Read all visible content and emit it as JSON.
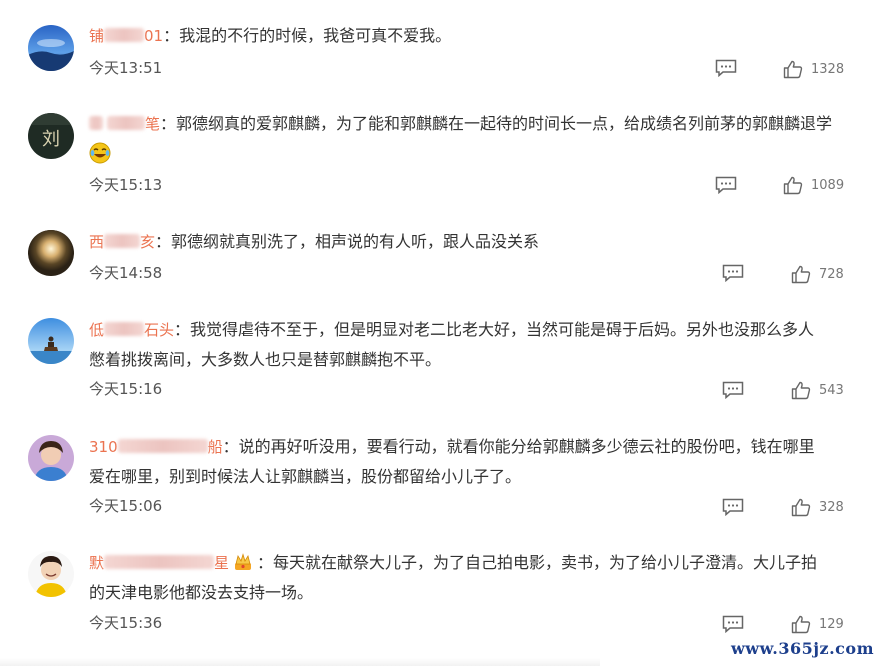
{
  "comments": [
    {
      "name_start": "铺",
      "name_end": "01",
      "text": "：我混的不行的时候，我爸可真不爱我。",
      "time": "今天13:51",
      "likes": "1328",
      "avatar": "avatar-blue-ocean"
    },
    {
      "name_start": "",
      "name_end": "笔",
      "text": "：郭德纲真的爱郭麒麟，为了能和郭麒麟在一起待的时间长一点，给成绩名列前茅的郭麒麟退学",
      "time": "今天15:13",
      "likes": "1089",
      "avatar": "avatar-dark-calligraphy",
      "avatar_char": "刘",
      "emoji": "crying-laughing-emoji"
    },
    {
      "name_start": "西",
      "name_end": "亥",
      "text": "：郭德纲就真别洗了，相声说的有人听，跟人品没关系",
      "time": "今天14:58",
      "likes": "728",
      "avatar": "avatar-moon"
    },
    {
      "name_start": "低",
      "name_end": "石头",
      "text_line1": "：我觉得虐待不至于，但是明显对老二比老大好，当然可能是碍于后妈。另外也没那么多人",
      "text_line2": "憋着挑拨离间，大多数人也只是替郭麒麟抱不平。",
      "time": "今天15:16",
      "likes": "543",
      "avatar": "avatar-sky-rider"
    },
    {
      "name_start": "310",
      "name_end": "船",
      "text_line1": "：说的再好听没用，要看行动，就看你能分给郭麒麟多少德云社的股份吧，钱在哪里",
      "text_line2": "爱在哪里，别到时候法人让郭麒麟当，股份都留给小儿子了。",
      "time": "今天15:06",
      "likes": "328",
      "avatar": "avatar-girl"
    },
    {
      "name_start": "默",
      "name_end": "星",
      "text_line1": "：每天就在献祭大儿子，为了自己拍电影，卖书，为了给小儿子澄清。大儿子拍",
      "text_line2": "的天津电影他都没去支持一场。",
      "time": "今天15:36",
      "likes": "129",
      "avatar": "avatar-boy",
      "badge": "crown-badge-icon"
    }
  ],
  "watermark": "www.365jz.com",
  "colors": {
    "username": "#eb7350",
    "text": "#333333",
    "meta": "#777777"
  }
}
